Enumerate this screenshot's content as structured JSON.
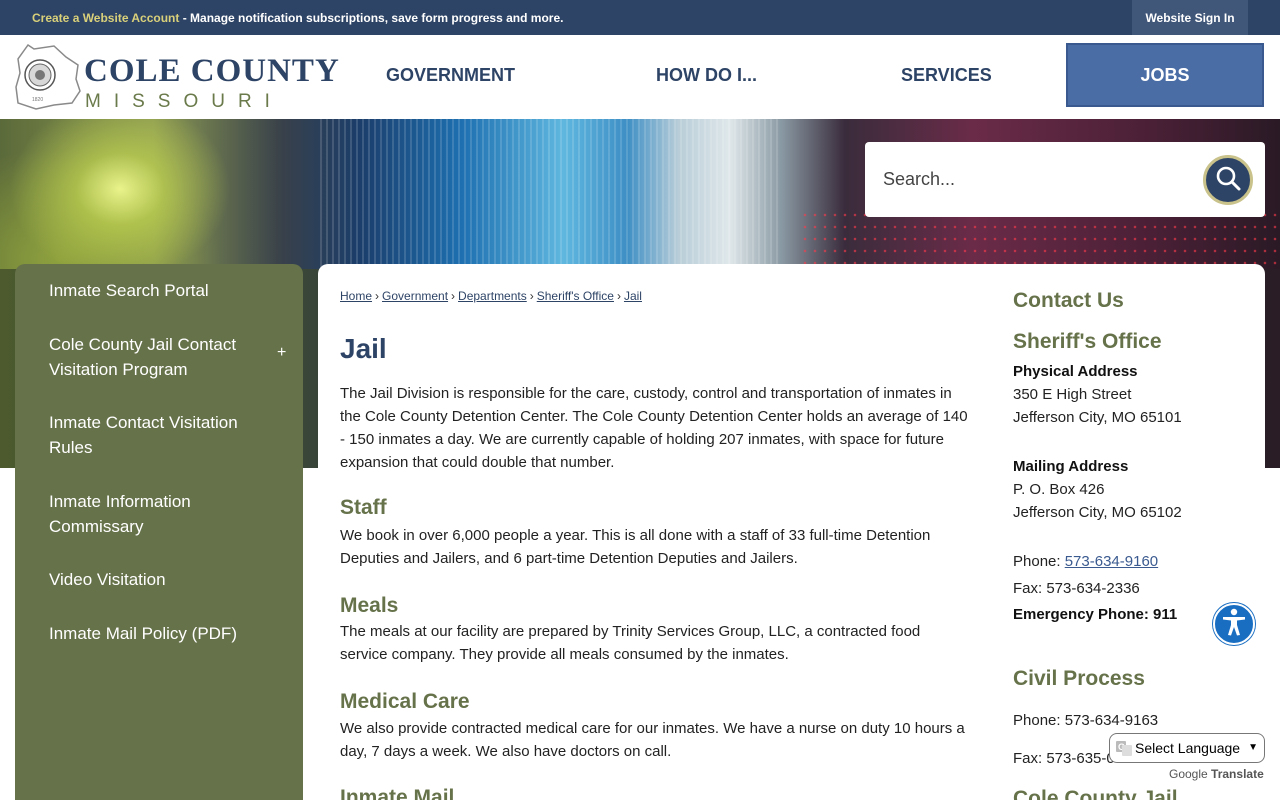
{
  "topbar": {
    "create_link": "Create a Website Account",
    "message": " - Manage notification subscriptions, save form progress and more.",
    "signin": "Website Sign In"
  },
  "logo": {
    "line1": "COLE COUNTY",
    "line2": "MISSOURI"
  },
  "nav": {
    "government": "GOVERNMENT",
    "how_do_i": "HOW DO I...",
    "services": "SERVICES",
    "jobs": "JOBS"
  },
  "search": {
    "placeholder": "Search..."
  },
  "sidenav": {
    "items": [
      "Inmate Search Portal",
      "Cole County Jail Contact Visitation Program",
      "Inmate Contact Visitation Rules",
      "Inmate Information Commissary",
      "Video Visitation",
      "Inmate Mail Policy (PDF)"
    ],
    "expand": "+"
  },
  "breadcrumb": [
    "Home",
    "Government",
    "Departments",
    "Sheriff's Office",
    "Jail"
  ],
  "breadcrumb_sep": "›",
  "page_title": "Jail",
  "intro": "The Jail Division is responsible for the care, custody, control and transportation of inmates in the Cole County Detention Center. The Cole County Detention Center holds an average of 140 - 150 inmates a day. We are currently capable of holding 207 inmates, with space for future expansion that could double that number.",
  "sections": [
    {
      "heading": "Staff",
      "text": "We book in over 6,000 people a year. This is all done with a staff of 33 full-time Detention Deputies and Jailers, and 6 part-time Detention Deputies and Jailers."
    },
    {
      "heading": "Meals",
      "text": "The meals at our facility are prepared by Trinity Services Group, LLC, a contracted food service company. They provide all meals consumed by the inmates."
    },
    {
      "heading": "Medical Care",
      "text": "We also provide contracted medical care for our inmates. We have a nurse on duty 10 hours a day, 7 days a week. We also have doctors on call."
    },
    {
      "heading": "Inmate Mail",
      "text": ""
    }
  ],
  "contact": {
    "heading": "Contact Us",
    "office": "Sheriff's Office",
    "physical_label": "Physical Address",
    "physical_line1": "350 E High Street",
    "physical_line2": "Jefferson City, MO 65101",
    "mailing_label": "Mailing Address",
    "mailing_line1": "P. O. Box 426",
    "mailing_line2": "Jefferson City, MO 65102",
    "phone_label": "Phone: ",
    "phone": "573-634-9160",
    "fax": "Fax: 573-634-2336",
    "emergency": "Emergency Phone: 911",
    "civil_heading": "Civil Process",
    "civil_phone": "Phone: 573-634-9163",
    "civil_fax": "Fax: 573-635-0",
    "next_heading": "Cole County Jail"
  },
  "translate": {
    "select_label": "Select Language",
    "google": "Google",
    "translate": "Translate"
  },
  "colors": {
    "navy": "#2e4466",
    "olive": "#66724a",
    "jobs_blue": "#4a6da6",
    "accessibility_blue": "#1a6ec2"
  },
  "icons": {
    "search": "magnifier-icon",
    "accessibility": "accessibility-person-icon",
    "seal": "county-seal-icon"
  }
}
